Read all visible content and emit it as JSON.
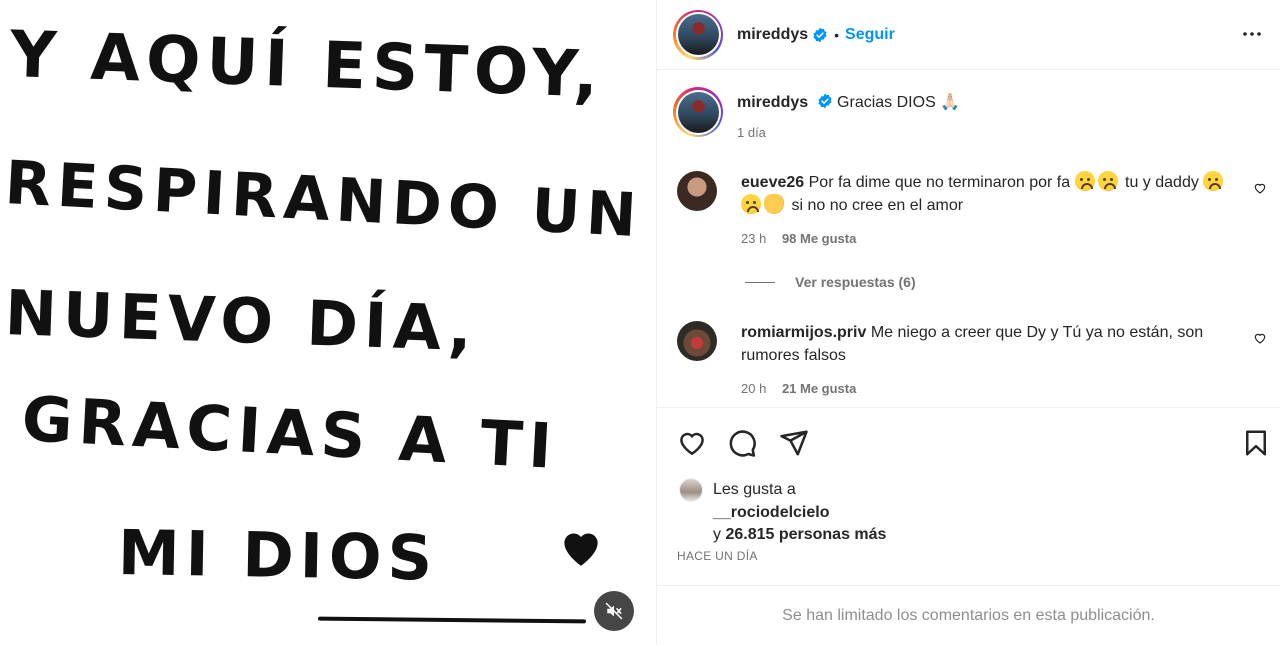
{
  "media": {
    "lines": [
      "Y AQUÍ ESTOY,",
      "RESPIRANDO UN",
      "NUEVO DÍA,",
      "GRACIAS A TI",
      "MI DIOS"
    ]
  },
  "header": {
    "username": "mireddys",
    "separator": "•",
    "follow_label": "Seguir"
  },
  "caption": {
    "username": "mireddys",
    "text": "Gracias DIOS 🙏🏻",
    "time": "1 día"
  },
  "comments": [
    {
      "username": "eueve26",
      "text_a": "Por fa dime que no terminaron por fa",
      "text_b": "tu y daddy",
      "text_c": "si no no cree en el amor",
      "time": "23 h",
      "likes": "98 Me gusta"
    },
    {
      "username": "romiarmijos.priv",
      "text": "Me niego a creer que Dy y Tú ya no están, son rumores falsos",
      "time": "20 h",
      "likes": "21 Me gusta"
    }
  ],
  "replies_label": "Ver respuestas (6)",
  "likes": {
    "prefix": "Les gusta a",
    "liker": "__rociodelcielo",
    "others_prefix": "y",
    "others": "26.815 personas más",
    "time": "HACE UN DÍA"
  },
  "footer_text": "Se han limitado los comentarios en esta publicación.",
  "icons": {
    "verified": "verified-badge-icon",
    "more": "more-options-icon",
    "like": "heart-icon",
    "comment": "comment-icon",
    "share": "share-icon",
    "save": "bookmark-icon",
    "mute": "muted-speaker-icon"
  },
  "colors": {
    "accent": "#0095f6",
    "secondary_text": "#737373",
    "border": "#efefef"
  }
}
